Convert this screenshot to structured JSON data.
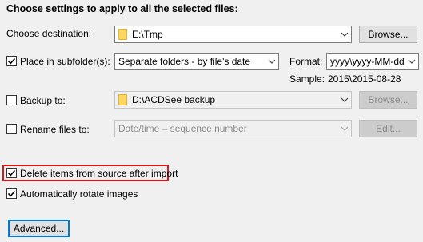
{
  "heading": "Choose settings to apply to all the selected files:",
  "destination": {
    "label": "Choose destination:",
    "value": "E:\\Tmp",
    "browse_label": "Browse..."
  },
  "subfolder": {
    "label": "Place in subfolder(s):",
    "checked": true,
    "value": "Separate folders - by file's date",
    "format_label": "Format:",
    "format_value": "yyyy\\yyyy-MM-dd",
    "sample_label": "Sample:",
    "sample_value": "2015\\2015-08-28"
  },
  "backup": {
    "label": "Backup to:",
    "checked": false,
    "value": "D:\\ACDSee backup",
    "browse_label": "Browse..."
  },
  "rename": {
    "label": "Rename files to:",
    "checked": false,
    "value": "Date/time – sequence number",
    "edit_label": "Edit..."
  },
  "delete_items": {
    "label": "Delete items from source after import",
    "checked": true
  },
  "auto_rotate": {
    "label": "Automatically rotate images",
    "checked": true
  },
  "advanced_label": "Advanced...",
  "colors": {
    "highlight_border": "#d9141b",
    "focus_border": "#0078d7",
    "folder_icon": "#ffd75e"
  },
  "icons": [
    "folder-icon",
    "chevron-down-icon",
    "checkmark-icon"
  ]
}
